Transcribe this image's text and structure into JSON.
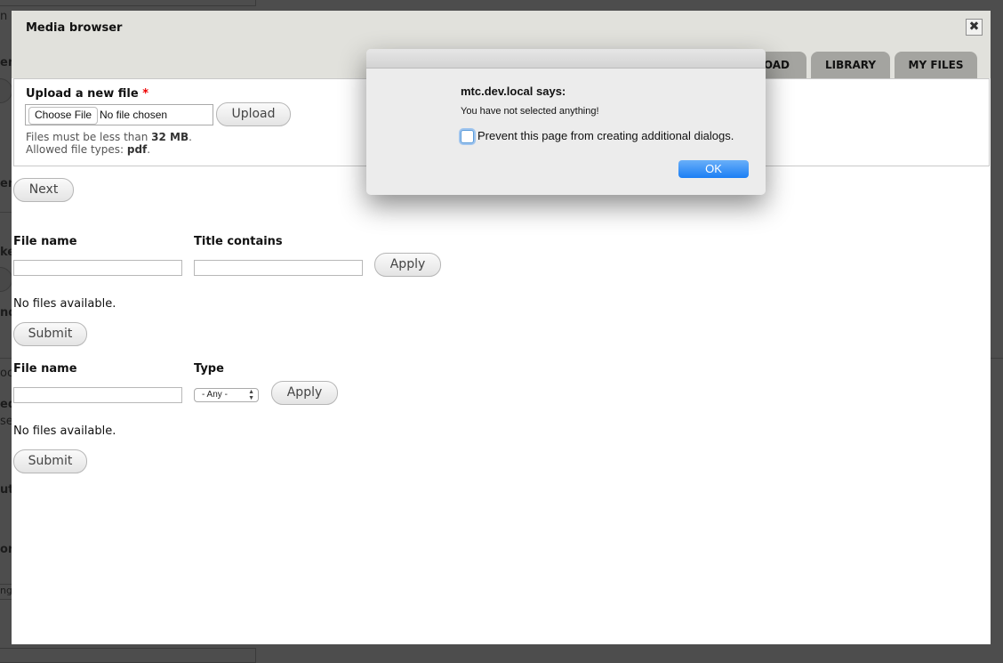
{
  "background_page": {
    "fragments": [
      "n C",
      "en",
      "en",
      "ke",
      "nd",
      "oc",
      "edi",
      "se",
      "ut",
      "or",
      "ng"
    ]
  },
  "modal": {
    "title": "Media browser",
    "close_icon": "close-icon",
    "tabs": [
      {
        "label": "OAD",
        "full_label": "UPLOAD"
      },
      {
        "label": "LIBRARY"
      },
      {
        "label": "MY FILES"
      }
    ],
    "upload": {
      "label": "Upload a new file",
      "required_marker": "*",
      "choose_file_label": "Choose File",
      "file_status": "No file chosen",
      "upload_button": "Upload",
      "size_hint_prefix": "Files must be less than",
      "size_limit": "32 MB",
      "types_hint_prefix": "Allowed file types:",
      "allowed_types": "pdf"
    },
    "next_button": "Next",
    "library_filter": {
      "file_name_label": "File name",
      "file_name_value": "",
      "title_label": "Title contains",
      "title_value": "",
      "apply_button": "Apply",
      "empty_text": "No files available.",
      "submit_button": "Submit"
    },
    "my_files_filter": {
      "file_name_label": "File name",
      "file_name_value": "",
      "type_label": "Type",
      "type_selected": "- Any -",
      "apply_button": "Apply",
      "empty_text": "No files available.",
      "submit_button": "Submit"
    }
  },
  "alert": {
    "title": "mtc.dev.local says:",
    "message": "You have not selected anything!",
    "checkbox_label": "Prevent this page from creating additional dialogs.",
    "checkbox_checked": false,
    "ok_button": "OK",
    "ok_color": "#1b7ef4"
  }
}
